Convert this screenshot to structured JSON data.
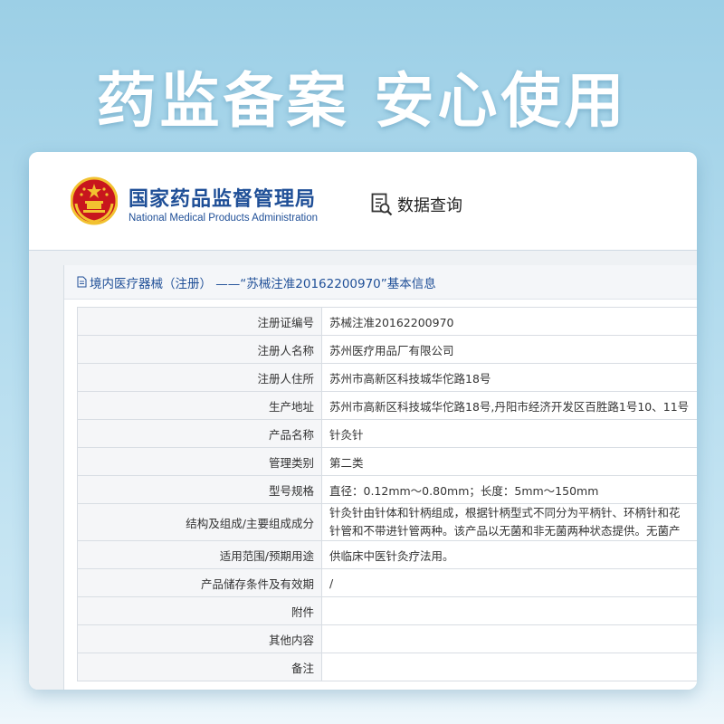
{
  "banner": {
    "headline": "药监备案 安心使用"
  },
  "header": {
    "org_name_cn": "国家药品监督管理局",
    "org_name_en": "National Medical Products Administration",
    "query_label": "数据查询",
    "emblem_icon": "national-emblem-icon",
    "query_icon": "document-search-icon"
  },
  "panel": {
    "title": "境内医疗器械（注册） ——“苏械注准20162200970”基本信息",
    "rows": [
      {
        "label": "注册证编号",
        "value": "苏械注准20162200970"
      },
      {
        "label": "注册人名称",
        "value": "苏州医疗用品厂有限公司"
      },
      {
        "label": "注册人住所",
        "value": "苏州市高新区科技城华佗路18号"
      },
      {
        "label": "生产地址",
        "value": "苏州市高新区科技城华佗路18号,丹阳市经济开发区百胜路1号10、11号"
      },
      {
        "label": "产品名称",
        "value": "针灸针"
      },
      {
        "label": "管理类别",
        "value": "第二类"
      },
      {
        "label": "型号规格",
        "value": "直径：0.12mm～0.80mm；长度：5mm～150mm"
      },
      {
        "label": "结构及组成/主要组成成分",
        "value": "针灸针由针体和针柄组成，根据针柄型式不同分为平柄针、环柄针和花",
        "value2": "针管和不带进针管两种。该产品以无菌和非无菌两种状态提供。无菌产"
      },
      {
        "label": "适用范围/预期用途",
        "value": "供临床中医针灸疗法用。"
      },
      {
        "label": "产品储存条件及有效期",
        "value": "/"
      },
      {
        "label": "附件",
        "value": ""
      },
      {
        "label": "其他内容",
        "value": ""
      },
      {
        "label": "备注",
        "value": ""
      }
    ]
  },
  "colors": {
    "brand_blue": "#1f4f97",
    "emblem_red": "#c8161d",
    "emblem_gold": "#f2c230"
  }
}
